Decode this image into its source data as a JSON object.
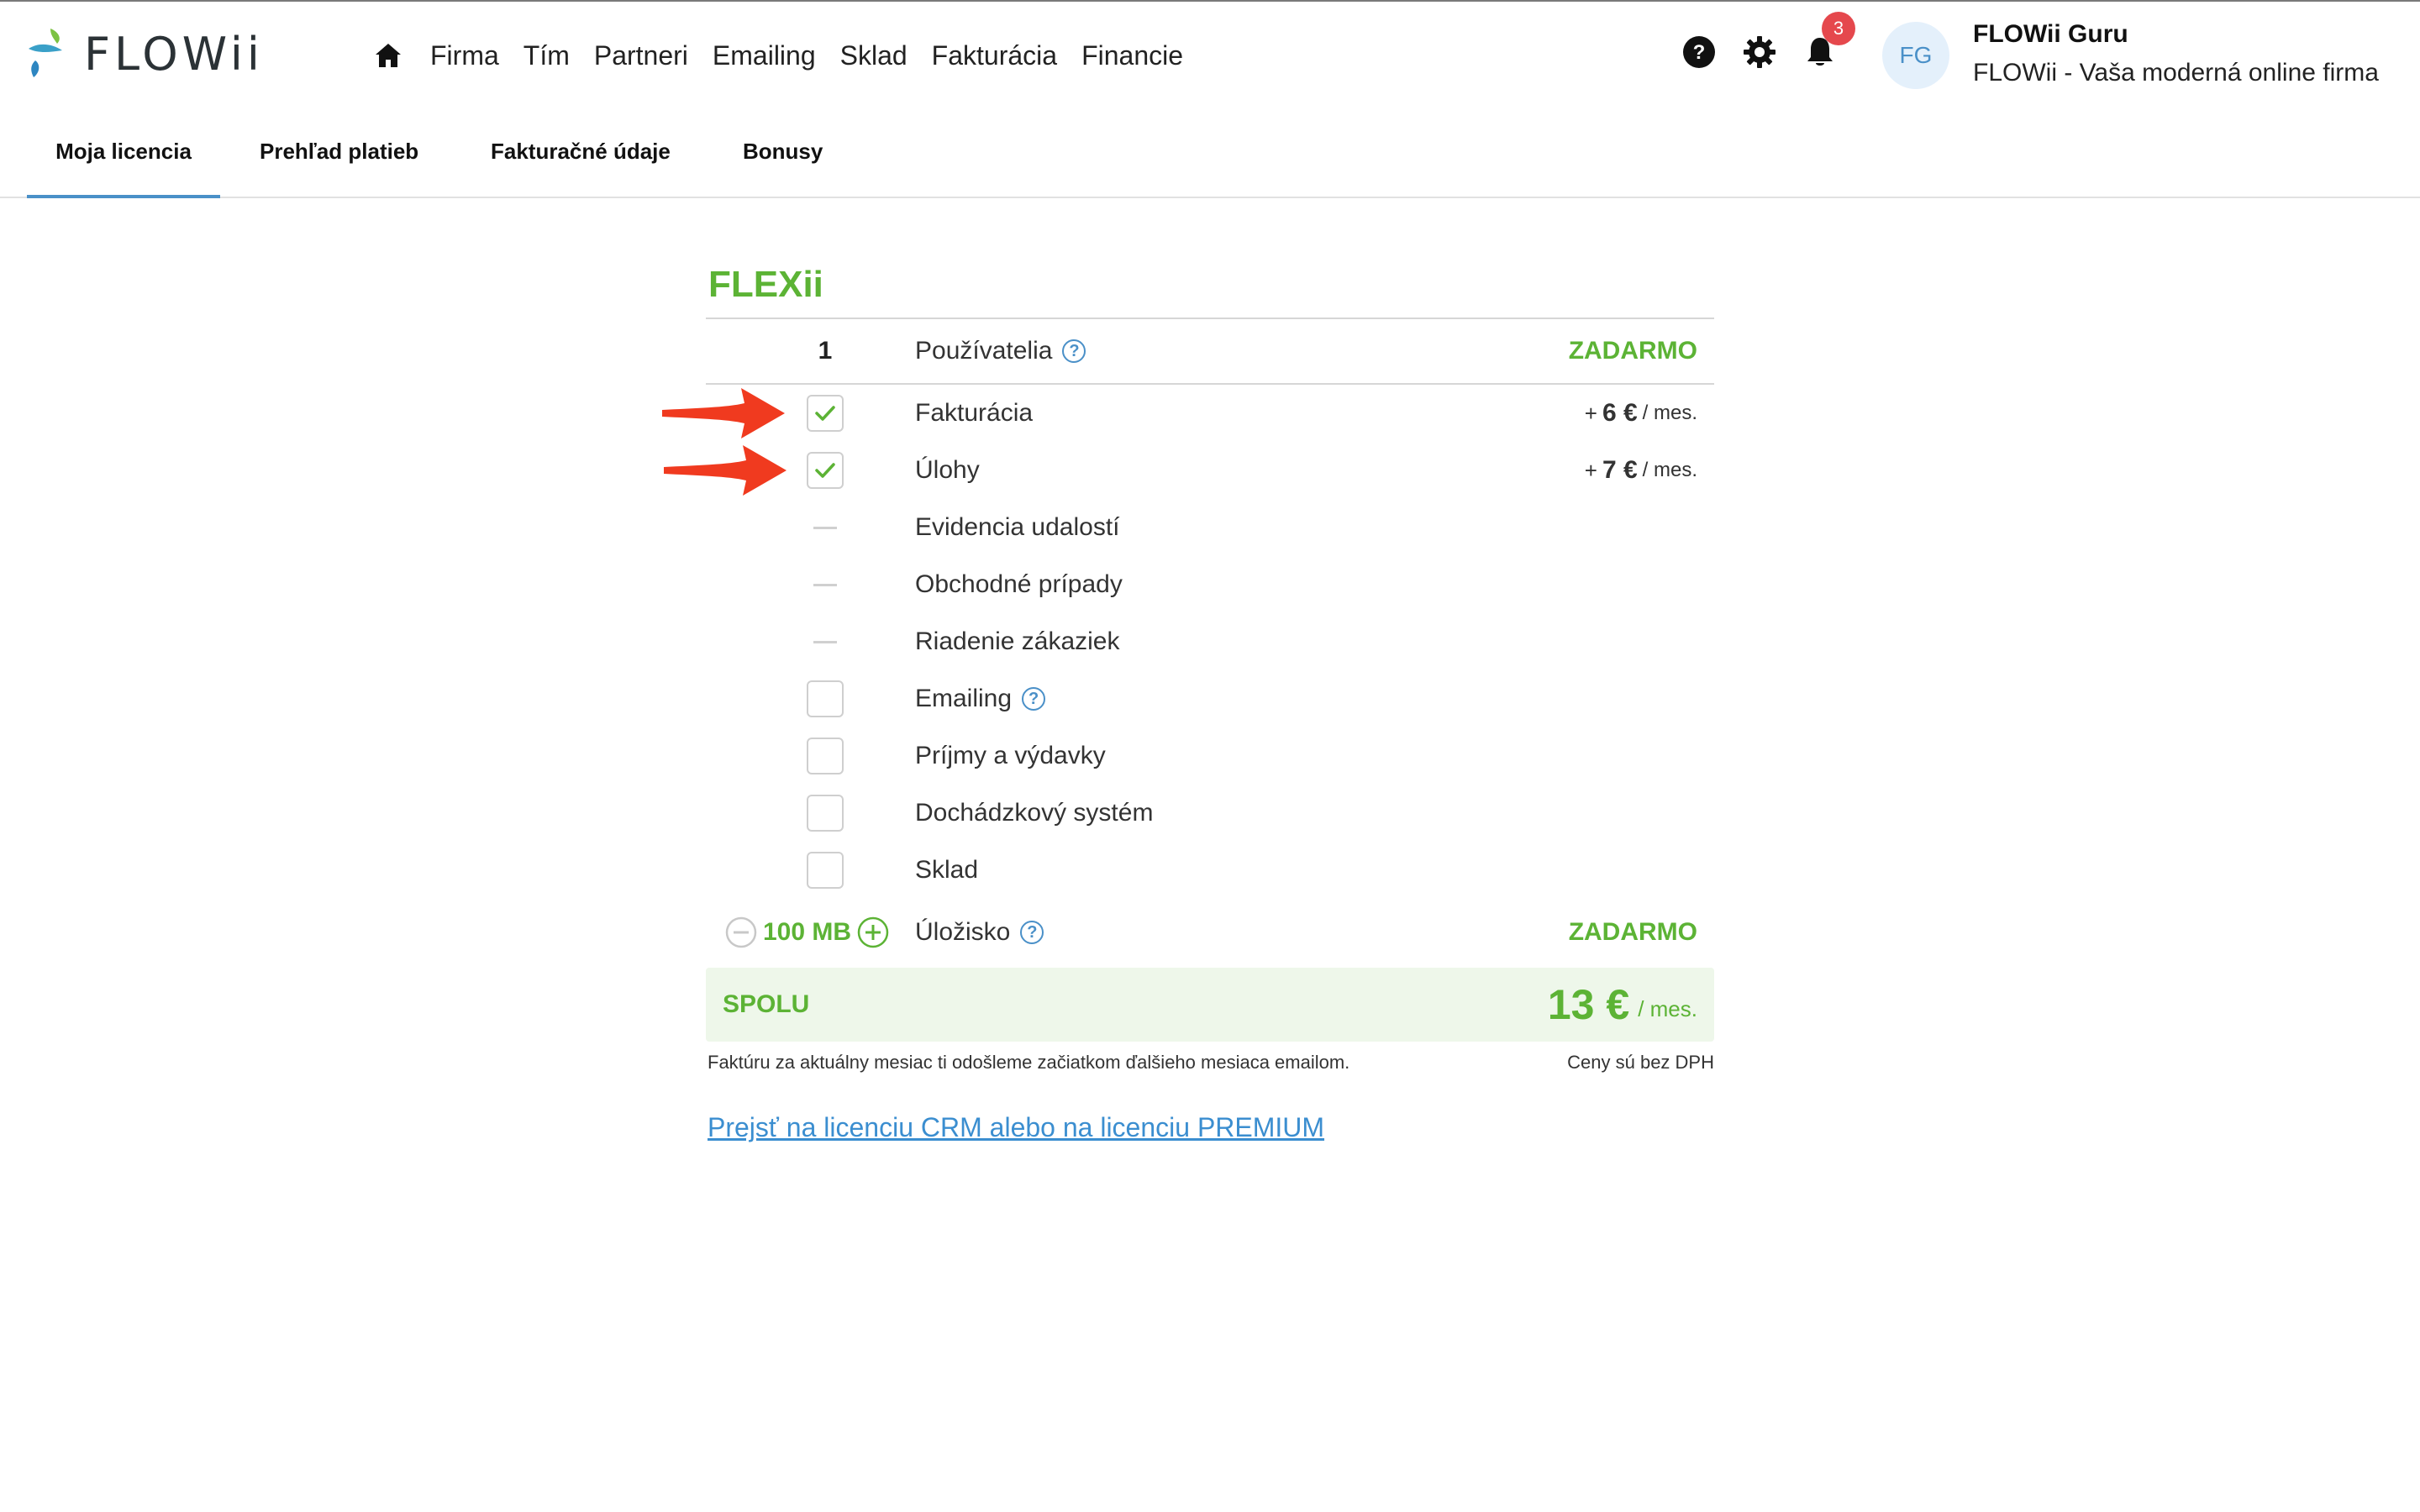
{
  "header": {
    "brand": "FLOWii",
    "nav": [
      "Firma",
      "Tím",
      "Partneri",
      "Emailing",
      "Sklad",
      "Fakturácia",
      "Financie"
    ],
    "notifications_count": "3",
    "avatar_initials": "FG",
    "user_name": "FLOWii Guru",
    "company_name": "FLOWii - Vaša moderná online firma"
  },
  "tabs": [
    "Moja licencia",
    "Prehľad platieb",
    "Fakturačné údaje",
    "Bonusy"
  ],
  "license": {
    "plan_name": "FLEXii",
    "users": {
      "count": "1",
      "label": "Používatelia",
      "price": "ZADARMO"
    },
    "modules": [
      {
        "label": "Fakturácia",
        "state": "checked",
        "price_prefix": "+",
        "price_amount": "6 €",
        "price_unit": "/ mes."
      },
      {
        "label": "Úlohy",
        "state": "checked",
        "price_prefix": "+",
        "price_amount": "7 €",
        "price_unit": "/ mes."
      },
      {
        "label": "Evidencia udalostí",
        "state": "unavailable"
      },
      {
        "label": "Obchodné prípady",
        "state": "unavailable"
      },
      {
        "label": "Riadenie zákaziek",
        "state": "unavailable"
      },
      {
        "label": "Emailing",
        "state": "unchecked",
        "help": true
      },
      {
        "label": "Príjmy a výdavky",
        "state": "unchecked"
      },
      {
        "label": "Dochádzkový systém",
        "state": "unchecked"
      },
      {
        "label": "Sklad",
        "state": "unchecked"
      }
    ],
    "storage": {
      "amount": "100 MB",
      "label": "Úložisko",
      "price": "ZADARMO"
    },
    "total": {
      "label": "SPOLU",
      "amount": "13 €",
      "unit": "/ mes."
    },
    "invoice_note": "Faktúru za aktuálny mesiac ti odošleme začiatkom ďalšieho mesiaca emailom.",
    "vat_note": "Ceny sú bez DPH",
    "upgrade_link": "Prejsť na licenciu CRM alebo na licenciu PREMIUM",
    "help_glyph": "?"
  },
  "colors": {
    "accent_green": "#5cb335",
    "link_blue": "#3b8ed0",
    "tab_underline": "#4a90c8",
    "badge_red": "#e5484d",
    "annotation_arrow": "#f03a1f"
  },
  "icons": [
    "home-icon",
    "help-circle-icon",
    "gear-icon",
    "bell-icon",
    "check-icon",
    "minus-circle-icon",
    "plus-circle-icon",
    "question-icon",
    "annotation-arrow"
  ]
}
